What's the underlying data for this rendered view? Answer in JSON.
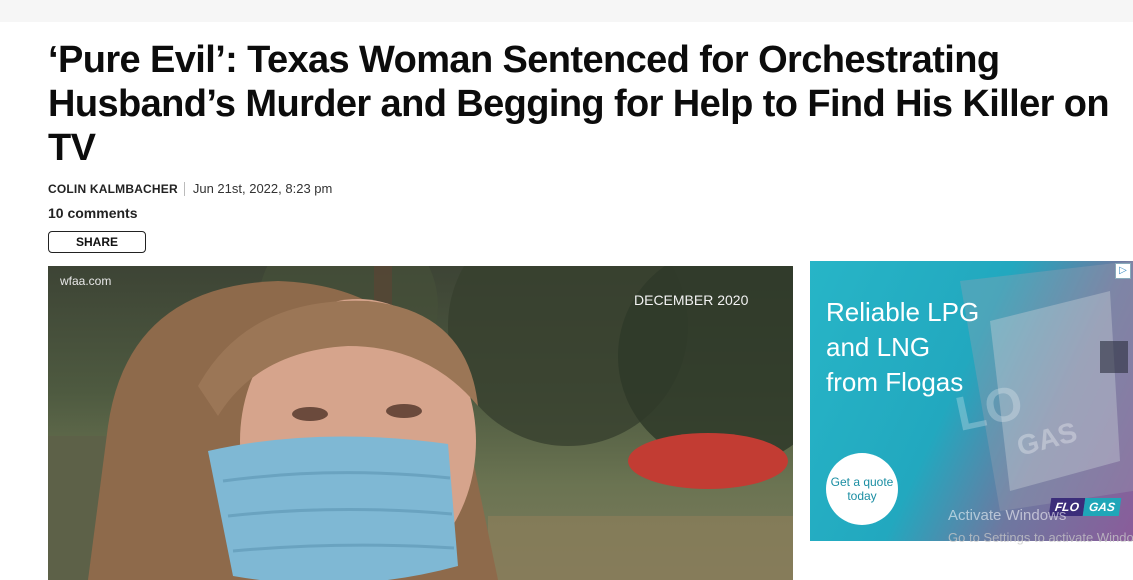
{
  "article": {
    "headline": "‘Pure Evil’: Texas Woman Sentenced for Orchestrating Husband’s Murder and Begging for Help to Find His Killer on TV",
    "author": "COLIN KALMBACHER",
    "date": "Jun 21st, 2022, 8:23 pm",
    "comments": "10 comments",
    "share_label": "SHARE"
  },
  "video": {
    "watermark": "wfaa.com",
    "date_caption": "DECEMBER 2020"
  },
  "ad": {
    "headline_lines": [
      "Reliable LPG",
      "and LNG",
      "from Flogas"
    ],
    "cta": "Get a quote today",
    "logo_flo": "FLO",
    "logo_gas": "GAS",
    "adchoices_icon": "adchoices-icon"
  },
  "os_watermark": {
    "title": "Activate Windows",
    "subtitle": "Go to Settings to activate Windows."
  }
}
